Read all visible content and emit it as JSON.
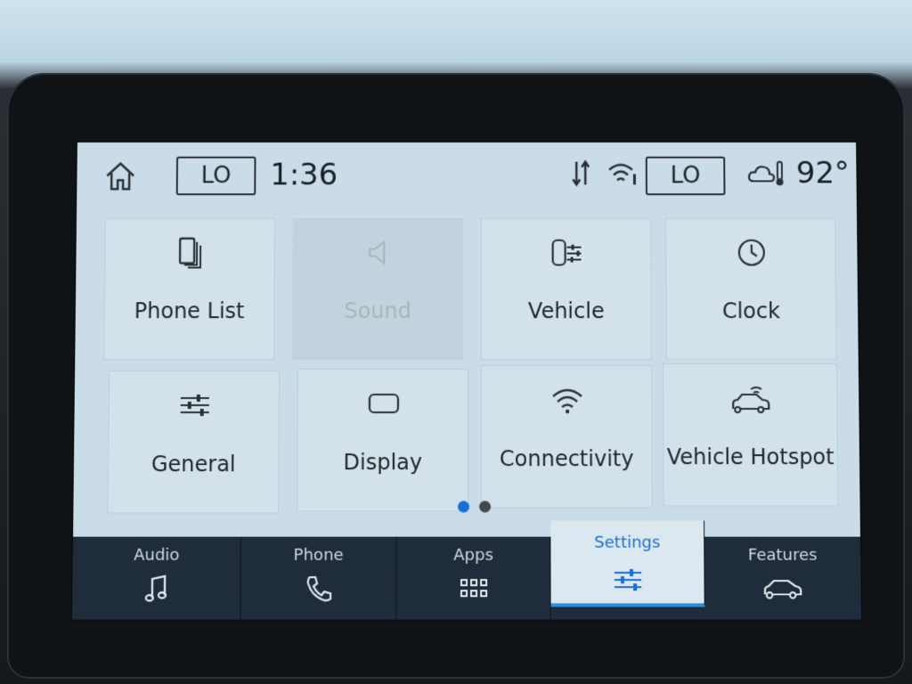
{
  "status_bar": {
    "left_climate": "LO",
    "time": "1:36",
    "right_climate": "LO",
    "temperature": "92°"
  },
  "tiles": [
    {
      "label": "Phone List",
      "icon": "phone-list-icon",
      "enabled": true
    },
    {
      "label": "Sound",
      "icon": "speaker-icon",
      "enabled": false
    },
    {
      "label": "Vehicle",
      "icon": "vehicle-settings-icon",
      "enabled": true
    },
    {
      "label": "Clock",
      "icon": "clock-icon",
      "enabled": true
    },
    {
      "label": "General",
      "icon": "sliders-icon",
      "enabled": true
    },
    {
      "label": "Display",
      "icon": "display-icon",
      "enabled": true
    },
    {
      "label": "Connectivity",
      "icon": "wifi-icon",
      "enabled": true
    },
    {
      "label": "Vehicle Hotspot",
      "icon": "car-hotspot-icon",
      "enabled": true
    }
  ],
  "pagination": {
    "current_page": 1,
    "total_pages": 2
  },
  "nav": [
    {
      "label": "Audio",
      "icon": "music-note-icon",
      "active": false
    },
    {
      "label": "Phone",
      "icon": "phone-handset-icon",
      "active": false
    },
    {
      "label": "Apps",
      "icon": "apps-grid-icon",
      "active": false
    },
    {
      "label": "Settings",
      "icon": "settings-sliders-icon",
      "active": true
    },
    {
      "label": "Features",
      "icon": "car-icon",
      "active": false
    }
  ],
  "colors": {
    "accent": "#1a6fd6",
    "nav_bg": "#1e2c3b",
    "screen_bg": "#c9dce7"
  }
}
